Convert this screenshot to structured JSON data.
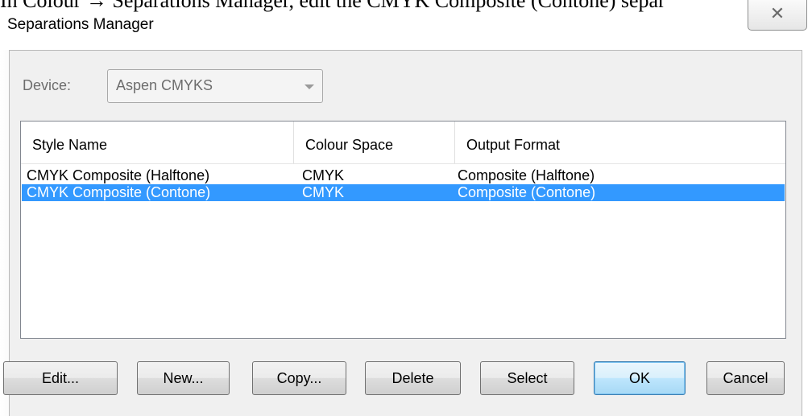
{
  "document": {
    "instruction_line": "In Colour → Separations Manager, edit the CMYK Composite (Contone) separ"
  },
  "window": {
    "title": "Separations Manager",
    "close_glyph": "✕"
  },
  "device": {
    "label": "Device:",
    "value": "Aspen CMYKS"
  },
  "list": {
    "columns": [
      "Style Name",
      "Colour Space",
      "Output Format"
    ],
    "rows": [
      {
        "style": "CMYK Composite (Halftone)",
        "space": "CMYK",
        "format": "Composite (Halftone)",
        "selected": false
      },
      {
        "style": "CMYK Composite (Contone)",
        "space": "CMYK",
        "format": "Composite (Contone)",
        "selected": true
      }
    ]
  },
  "buttons": {
    "edit": "Edit...",
    "new": "New...",
    "copy": "Copy...",
    "delete": "Delete",
    "select": "Select",
    "ok": "OK",
    "cancel": "Cancel"
  },
  "colors": {
    "selection": "#3399ff",
    "dialog_bg": "#f0f0f0",
    "ok_border": "#3c7fb1"
  }
}
